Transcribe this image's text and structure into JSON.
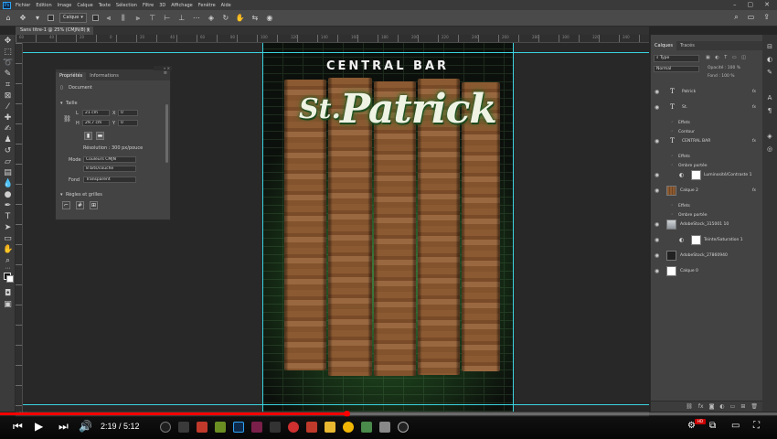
{
  "app": {
    "menu": [
      "Fichier",
      "Edition",
      "Image",
      "Calque",
      "Texte",
      "Sélection",
      "Filtre",
      "3D",
      "Affichage",
      "Fenêtre",
      "Aide"
    ],
    "logo": "Ps"
  },
  "options_bar": {
    "auto_select_label": "Calque",
    "transform_label": ""
  },
  "document": {
    "tab_title": "Sans titre-1 @ 25% (CMJN/8) *",
    "zoom": "25%"
  },
  "ruler": {
    "top_ticks": [
      "60",
      "40",
      "20",
      "0",
      "20",
      "40",
      "60",
      "80",
      "100",
      "120",
      "140",
      "160",
      "180",
      "200",
      "220",
      "240",
      "260",
      "280",
      "300",
      "320",
      "340"
    ]
  },
  "properties_panel": {
    "tabs": [
      "Propriétés",
      "Informations"
    ],
    "doc_label": "Document",
    "section_size": "Taille",
    "width_label": "L",
    "width_value": "21 cm",
    "height_label": "H",
    "height_value": "29,7 cm",
    "x_label": "X",
    "x_value": "0",
    "y_label": "Y",
    "y_value": "0",
    "resolution": "Résolution : 300 px/pouce",
    "mode_label": "Mode",
    "mode_value": "Couleurs CMJN",
    "depth_value": "8 bits/couche",
    "fill_label": "Fond",
    "fill_value": "Transparent",
    "section_rulers": "Règles et grilles"
  },
  "artboard": {
    "header": "CENTRAL BAR",
    "title_st": "St.",
    "title_main": "Patrick"
  },
  "layers_panel": {
    "tabs": [
      "Calques",
      "Tracés"
    ],
    "search_placeholder": "Type",
    "blend_mode": "Normal",
    "opacity_label": "Opacité : 100 %",
    "fill_label": "Fond : 100 %",
    "layers": [
      {
        "kind": "text",
        "name": "Patrick",
        "fx": "fx"
      },
      {
        "kind": "text",
        "name": "St.",
        "fx": "fx"
      },
      {
        "kind": "sub",
        "name": "Effets"
      },
      {
        "kind": "sub",
        "name": "Contour"
      },
      {
        "kind": "text",
        "name": "CENTRAL BAR",
        "fx": "fx"
      },
      {
        "kind": "sub",
        "name": "Effets"
      },
      {
        "kind": "sub",
        "name": "Ombre portée"
      },
      {
        "kind": "adj",
        "name": "Luminosité/Contraste 1"
      },
      {
        "kind": "wood",
        "name": "Calque 2",
        "fx": "fx"
      },
      {
        "kind": "sub",
        "name": "Effets"
      },
      {
        "kind": "sub",
        "name": "Ombre portée"
      },
      {
        "kind": "photo",
        "name": "AdobeStock_315001 10"
      },
      {
        "kind": "adj",
        "name": "Teinte/Saturation 1"
      },
      {
        "kind": "dark",
        "name": "AdobeStock_27860940"
      },
      {
        "kind": "white",
        "name": "Calque 0"
      }
    ]
  },
  "status_bar": {
    "text": "25 %"
  },
  "video": {
    "time": "2:19 / 5:12",
    "progress": 0.446
  },
  "colors": {
    "accent_red": "#ff0000",
    "guide": "#3ad3e0",
    "ui_dark": "#434343"
  }
}
